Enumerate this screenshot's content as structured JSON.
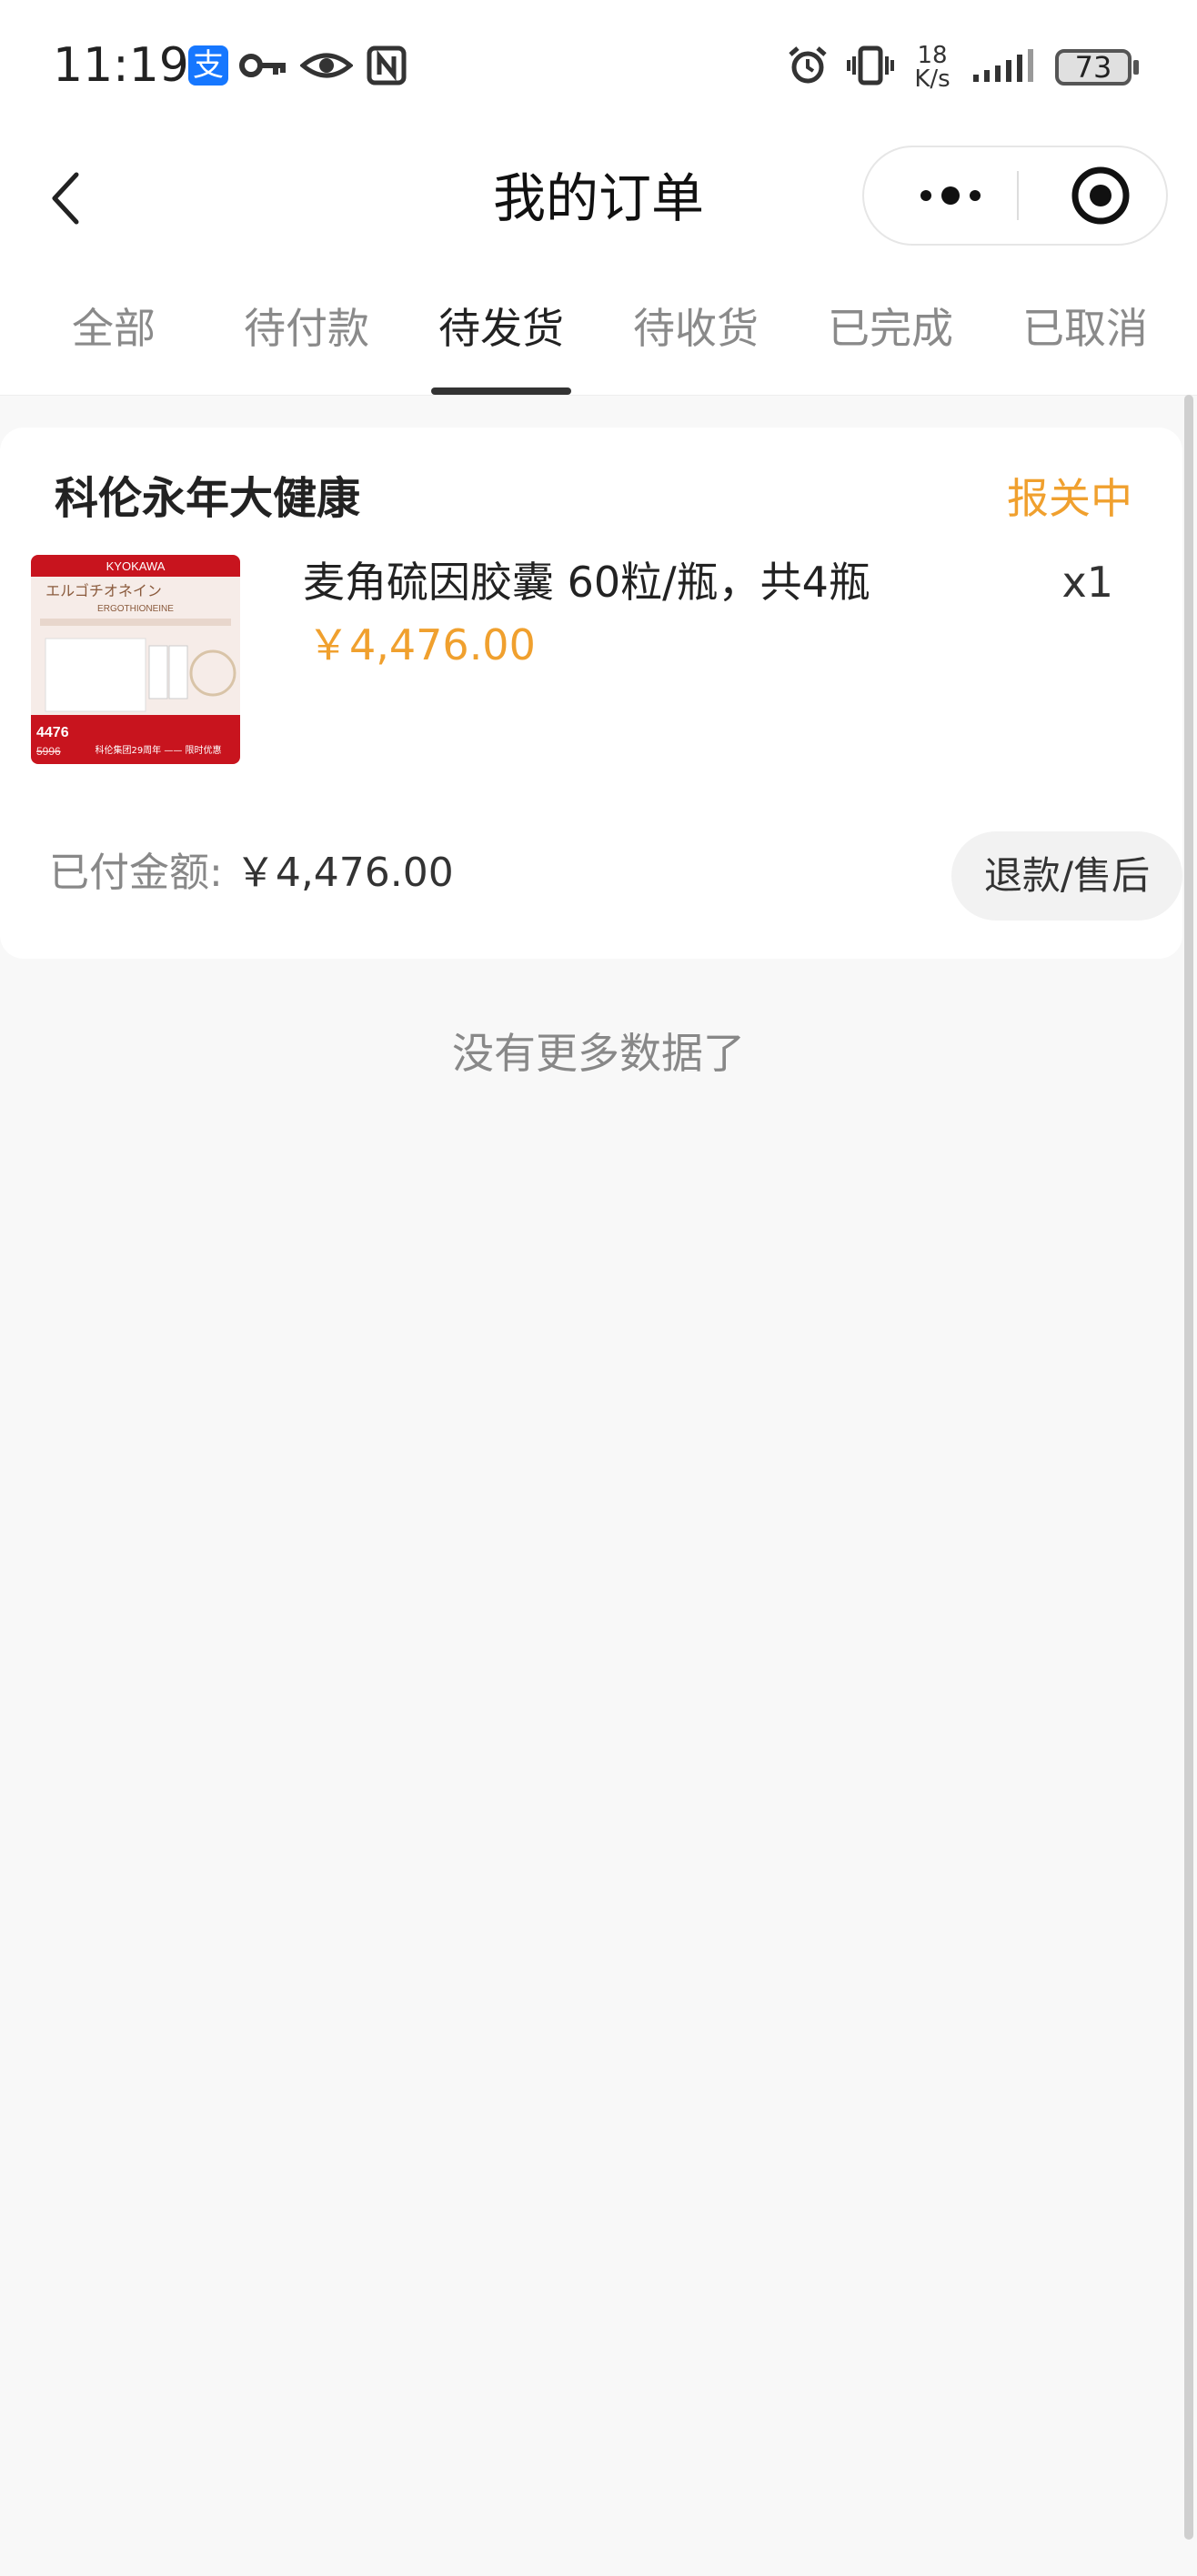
{
  "status_bar": {
    "time": "11:19",
    "alipay_glyph": "支",
    "net_speed_value": "18",
    "net_speed_unit": "K/s",
    "battery": "73",
    "icons": [
      "alipay-icon",
      "key-icon",
      "eye-icon",
      "nfc-icon",
      "alarm-icon",
      "vibrate-icon",
      "signal-icon",
      "battery-icon"
    ]
  },
  "navbar": {
    "title": "我的订单",
    "icons": [
      "back-chevron-icon",
      "more-dots-icon",
      "close-target-icon"
    ]
  },
  "tabs": [
    {
      "label": "全部",
      "active": false
    },
    {
      "label": "待付款",
      "active": false
    },
    {
      "label": "待发货",
      "active": true
    },
    {
      "label": "待收货",
      "active": false
    },
    {
      "label": "已完成",
      "active": false
    },
    {
      "label": "已取消",
      "active": false
    }
  ],
  "order": {
    "shop_name": "科伦永年大健康",
    "status": "报关中",
    "product": {
      "name": "麦角硫因胶囊 60粒/瓶，共4瓶",
      "price": "￥4,476.00",
      "quantity": "x1",
      "thumb_text": {
        "brand": "KYOKAWA",
        "jp_title": "エルゴチオネイン",
        "en_title": "ERGOTHIONEINE",
        "price_now": "4476",
        "price_old": "5996",
        "banner": "科伦集团29周年 —— 限时优惠"
      }
    },
    "paid_label": "已付金额:",
    "paid_amount": "￥4,476.00",
    "refund_button": "退款/售后"
  },
  "footer_text": "没有更多数据了",
  "colors": {
    "accent_orange": "#f0a02e",
    "alipay_blue": "#1677ff",
    "thumb_red": "#c8141e"
  }
}
